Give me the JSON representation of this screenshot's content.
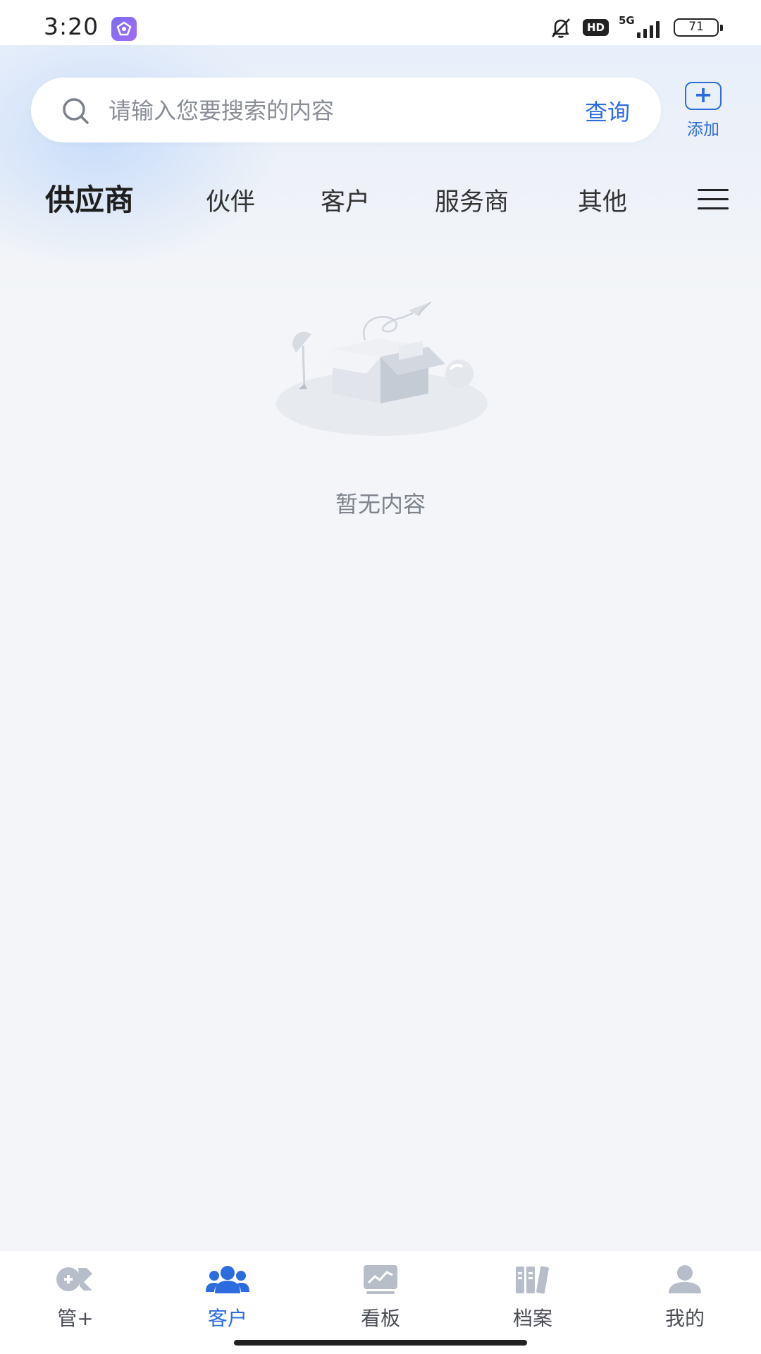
{
  "status_bar": {
    "time": "3:20",
    "hd_label": "HD",
    "network": "5G",
    "battery": "71"
  },
  "search": {
    "placeholder": "请输入您要搜索的内容",
    "query_label": "查询"
  },
  "add_button": {
    "label": "添加"
  },
  "tabs": [
    {
      "label": "供应商",
      "active": true
    },
    {
      "label": "伙伴",
      "active": false
    },
    {
      "label": "客户",
      "active": false
    },
    {
      "label": "服务商",
      "active": false
    },
    {
      "label": "其他",
      "active": false
    }
  ],
  "empty_state": {
    "message": "暂无内容"
  },
  "bottom_nav": [
    {
      "label": "管+",
      "icon": "manage-plus-icon",
      "active": false
    },
    {
      "label": "客户",
      "icon": "customers-icon",
      "active": true
    },
    {
      "label": "看板",
      "icon": "dashboard-icon",
      "active": false
    },
    {
      "label": "档案",
      "icon": "archive-icon",
      "active": false
    },
    {
      "label": "我的",
      "icon": "profile-icon",
      "active": false
    }
  ],
  "colors": {
    "accent": "#2d6cdf",
    "background": "#f3f5f8",
    "text_muted": "#7f848c",
    "inactive_icon": "#b7bec9"
  }
}
